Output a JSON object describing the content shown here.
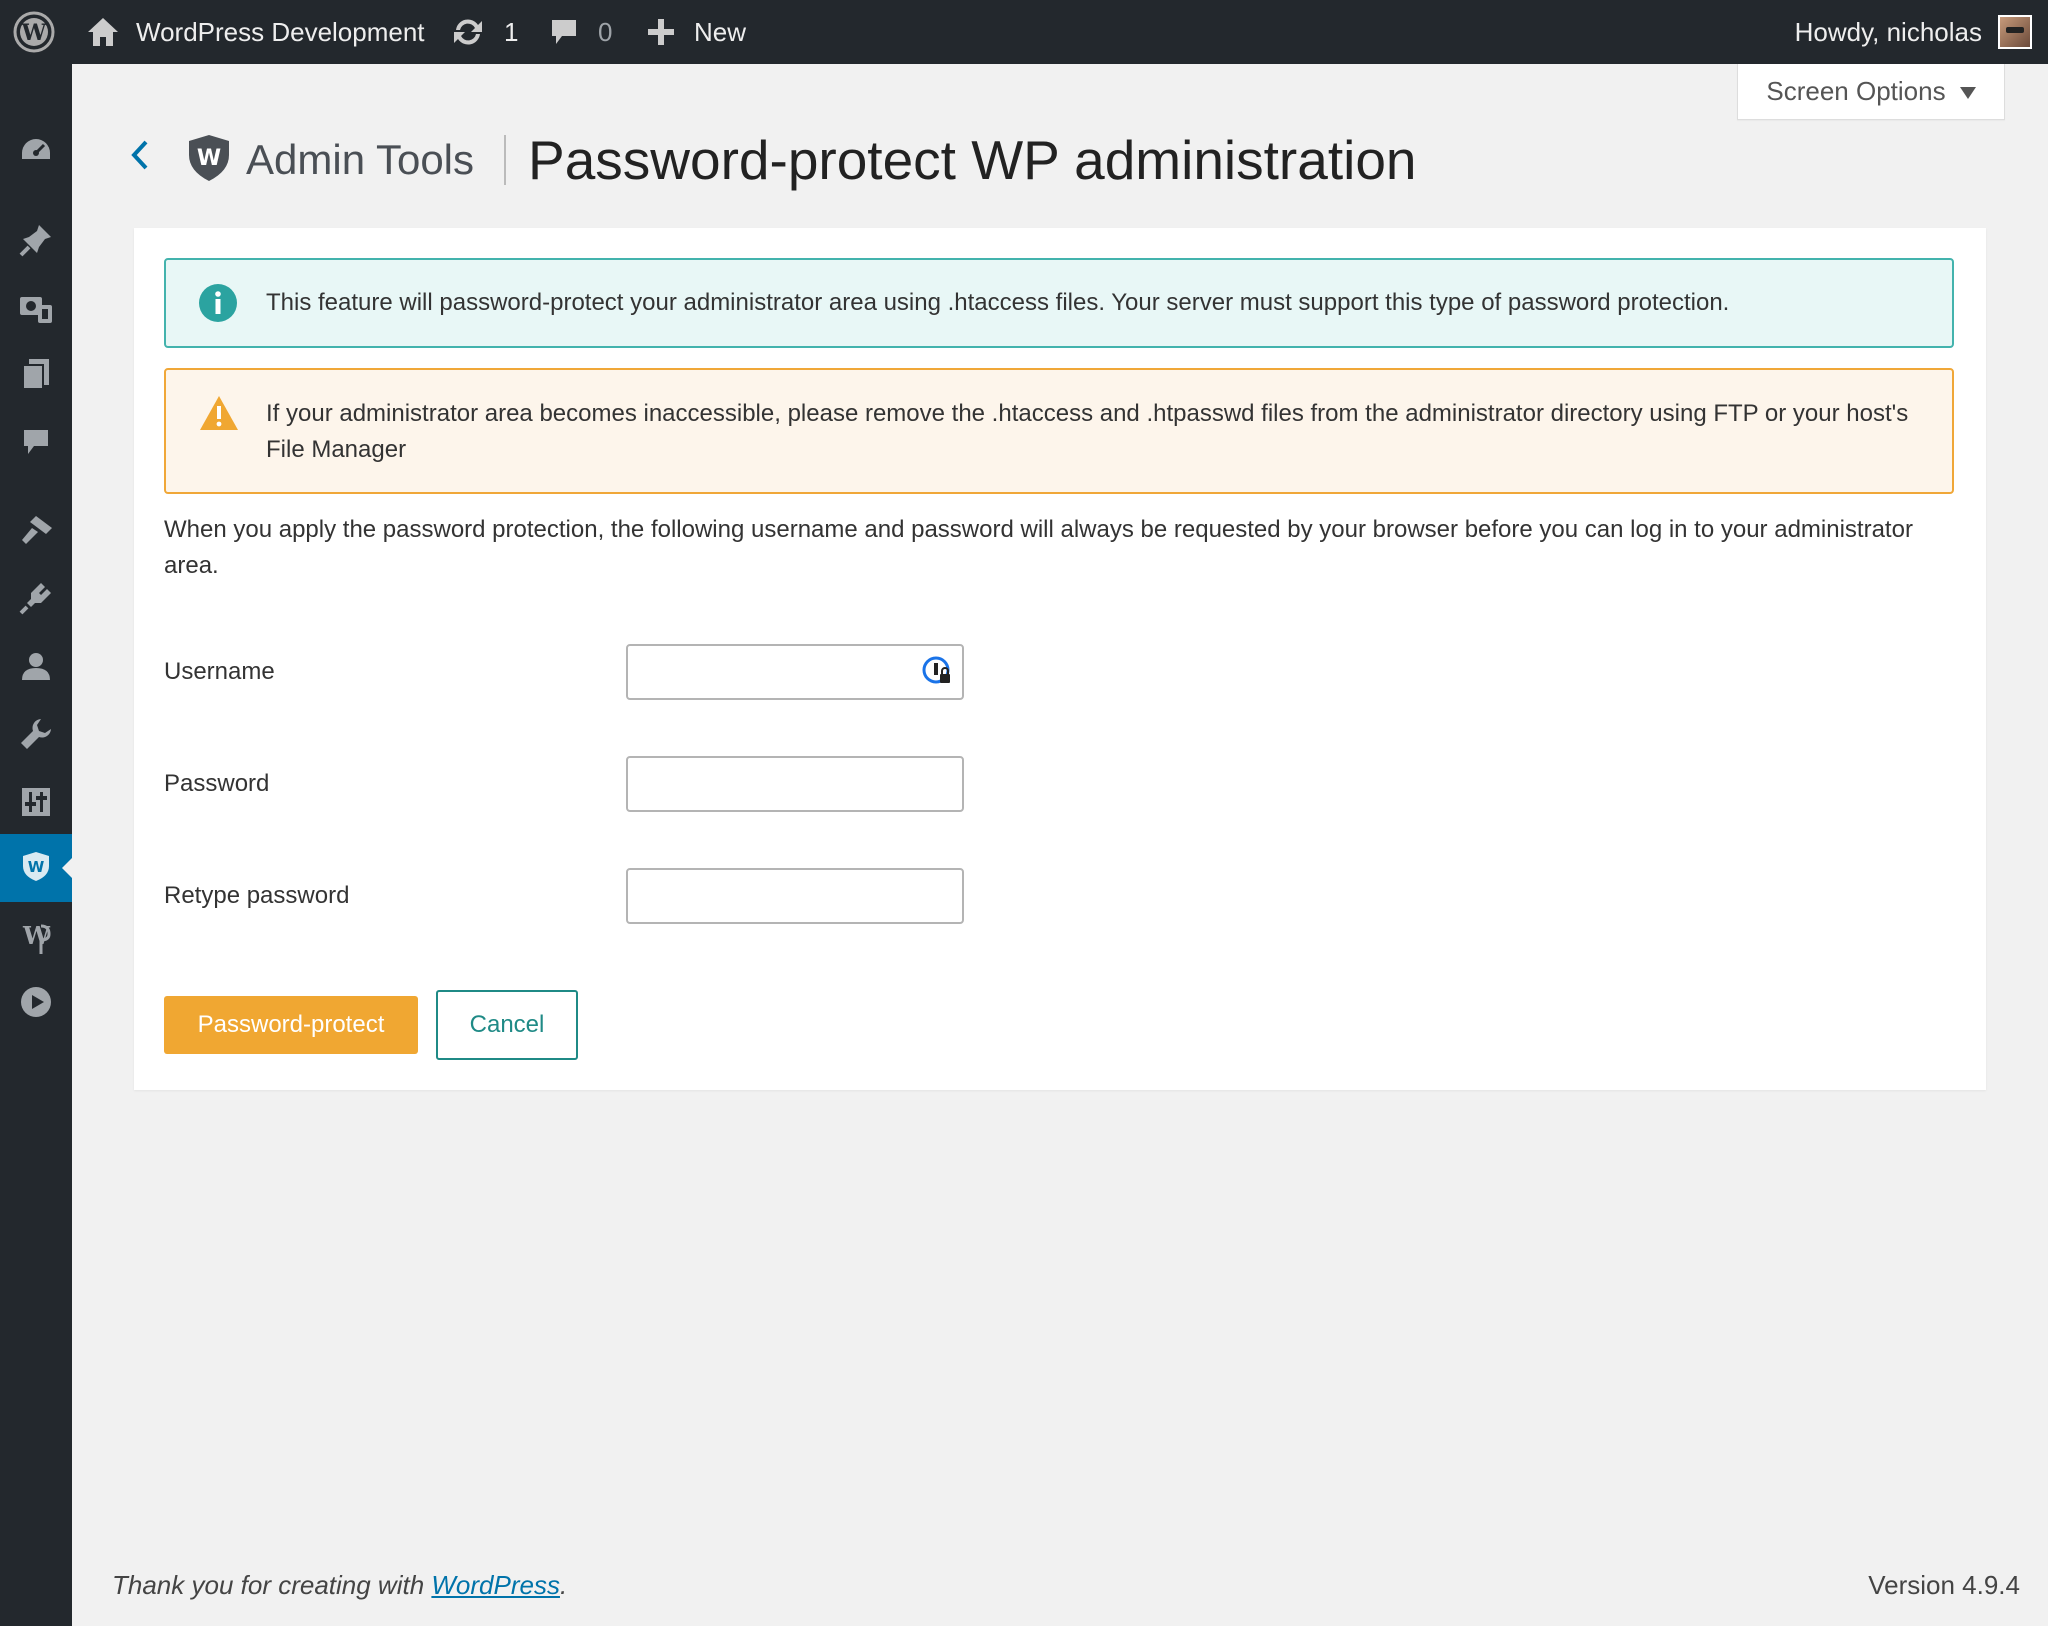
{
  "adminbar": {
    "site_name": "WordPress Development",
    "updates_count": "1",
    "comments_count": "0",
    "new_label": "New",
    "howdy": "Howdy, nicholas"
  },
  "screen_options": {
    "label": "Screen Options"
  },
  "header": {
    "brand": "Admin Tools",
    "title": "Password-protect WP administration"
  },
  "alerts": {
    "info": "This feature will password-protect your administrator area using .htaccess files. Your server must support this type of password protection.",
    "warning": "If your administrator area becomes inaccessible, please remove the .htaccess and .htpasswd files from the administrator directory using FTP or your host's File Manager"
  },
  "intro": "When you apply the password protection, the following username and password will always be requested by your browser before you can log in to your administrator area.",
  "form": {
    "username_label": "Username",
    "username_value": "",
    "password_label": "Password",
    "password_value": "",
    "retype_label": "Retype password",
    "retype_value": ""
  },
  "buttons": {
    "protect": "Password-protect",
    "cancel": "Cancel"
  },
  "footer": {
    "thanks_prefix": "Thank you for creating with ",
    "thanks_link": "WordPress",
    "thanks_suffix": ".",
    "version": "Version 4.9.4"
  },
  "sidebar": {
    "items": [
      "dashboard-icon",
      "pin-icon",
      "media-icon",
      "pages-icon",
      "comments-icon",
      "appearance-icon",
      "plugins-icon",
      "users-icon",
      "tools-icon",
      "settings-icon",
      "admintools-icon",
      "wpml-icon",
      "video-icon"
    ]
  },
  "colors": {
    "adminbar": "#23282d",
    "accent_blue": "#0073aa",
    "info_border": "#43b3ad",
    "warning_border": "#f0a738",
    "primary_button": "#f0a732",
    "cancel_button": "#1f8a86"
  }
}
